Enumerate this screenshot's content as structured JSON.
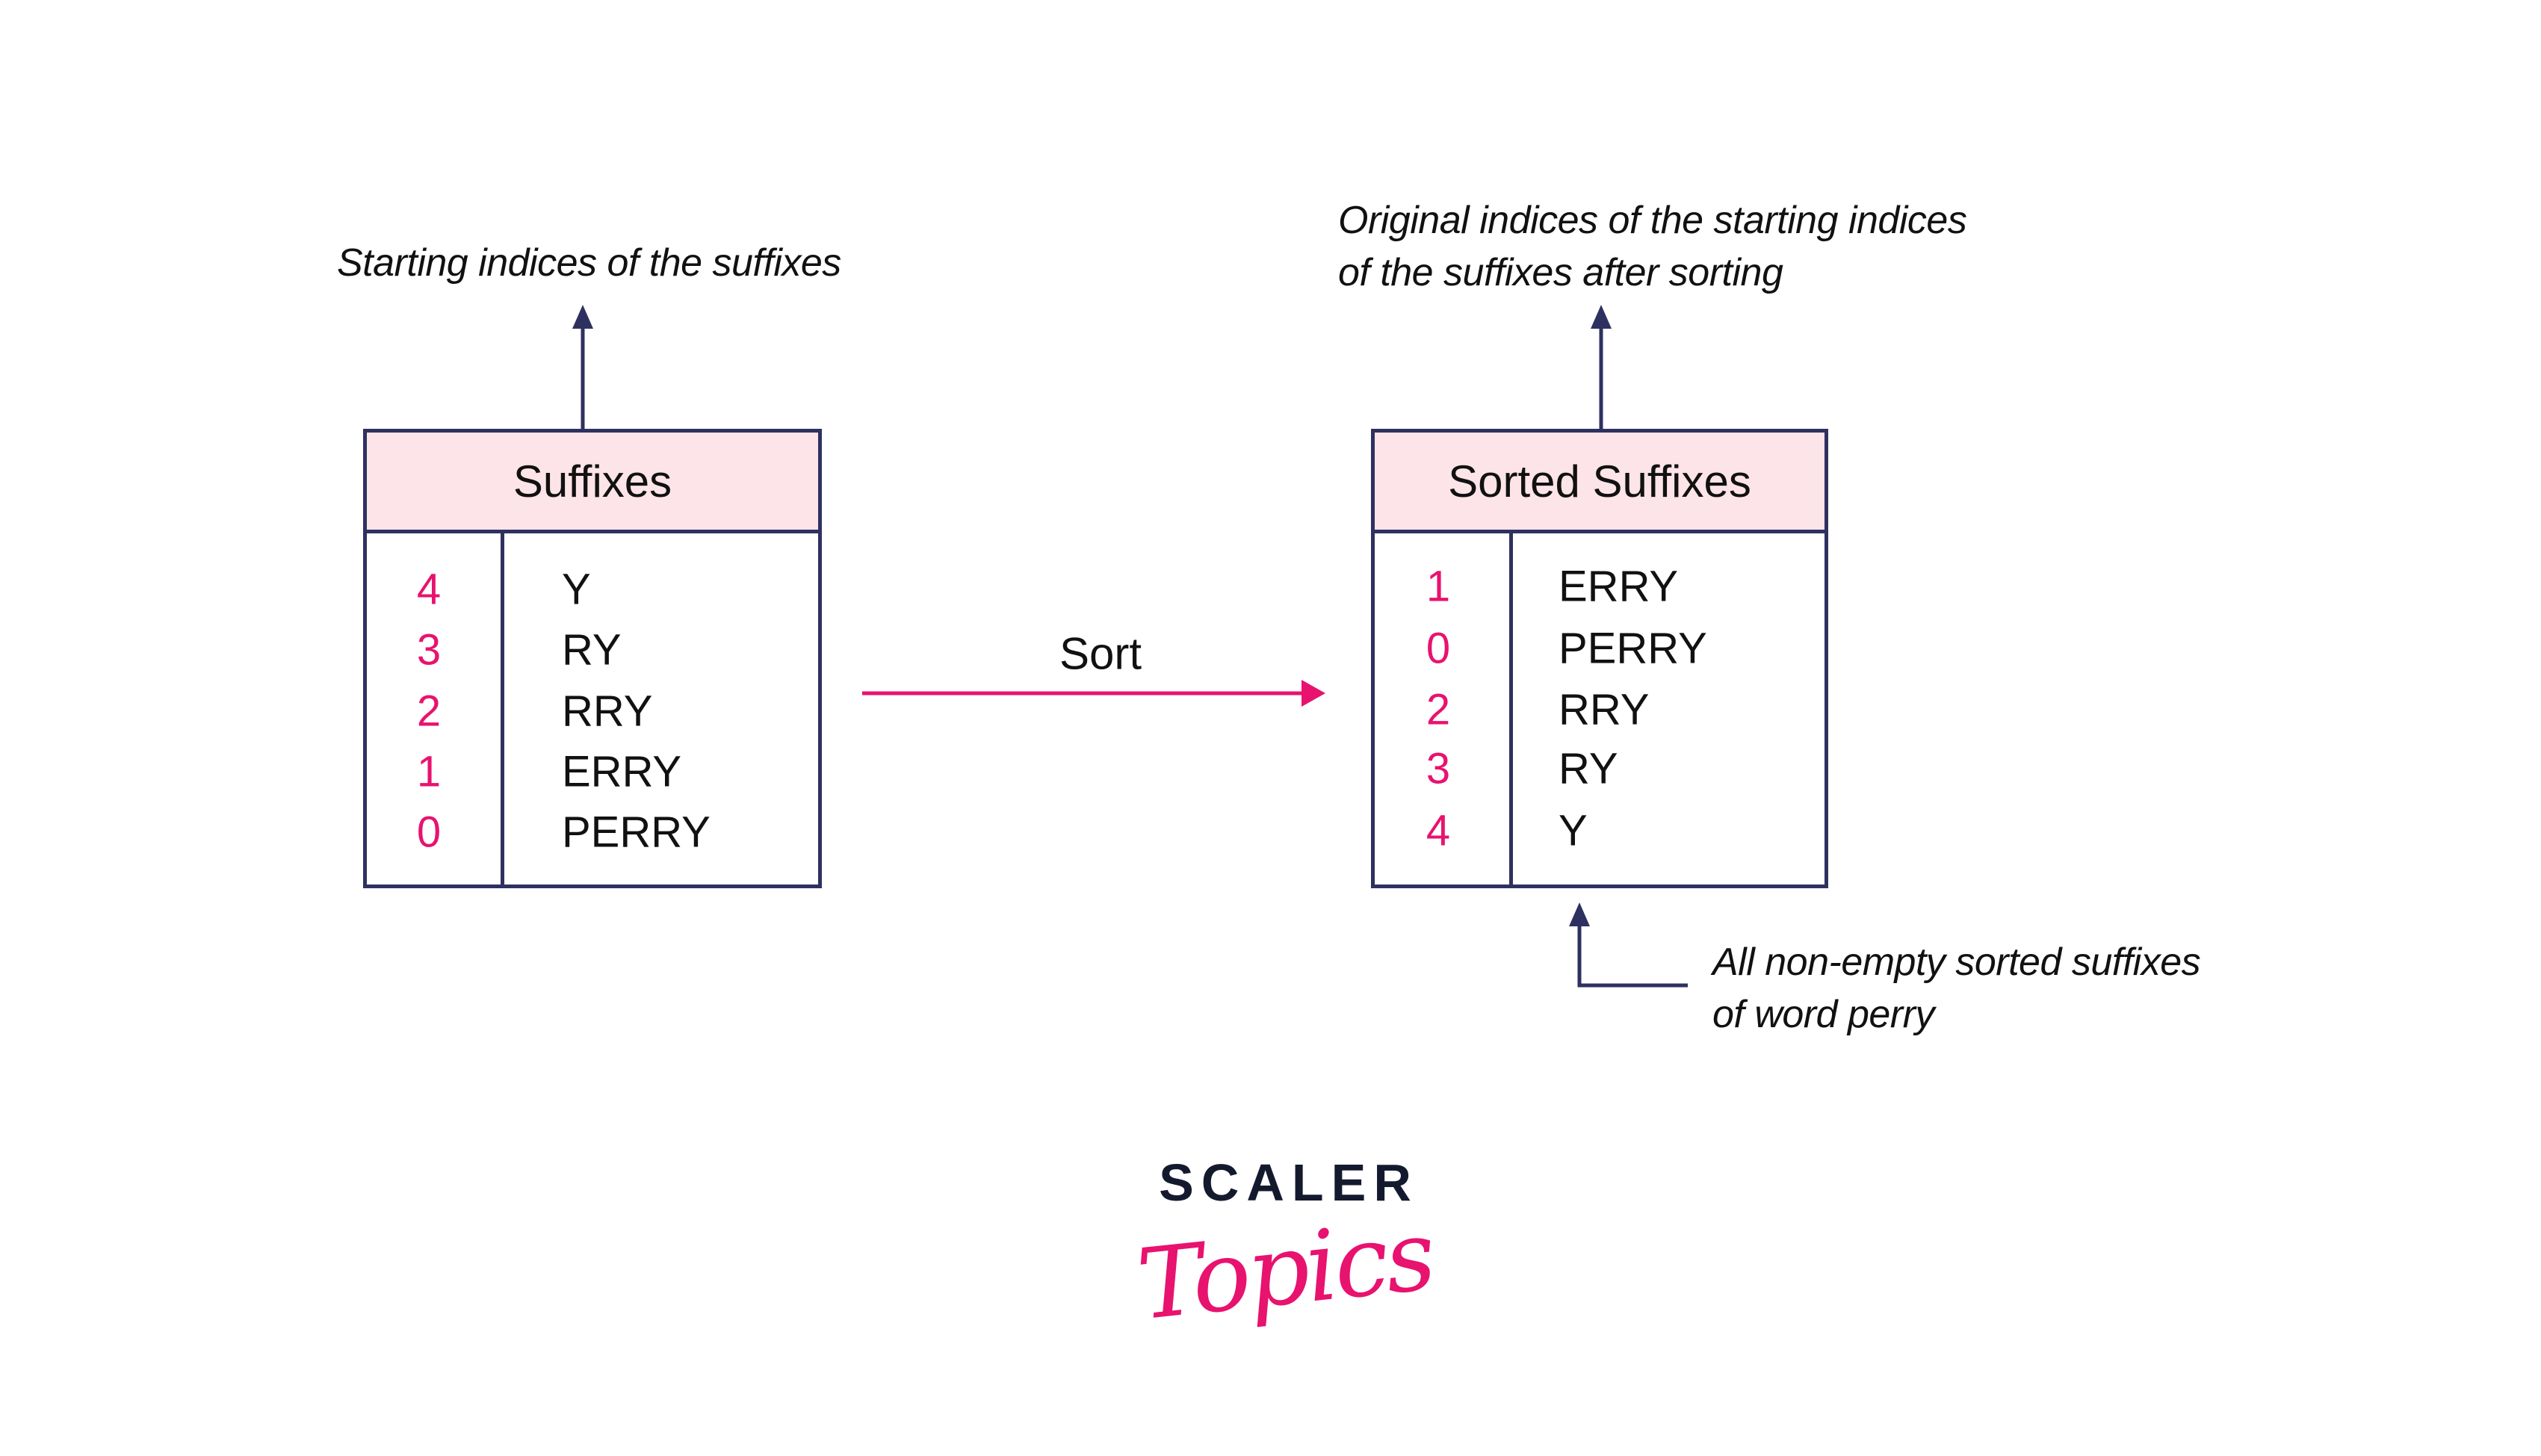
{
  "left_panel": {
    "caption": "Starting indices of the suffixes",
    "table_title": "Suffixes",
    "rows": [
      {
        "index": "4",
        "suffix": "Y"
      },
      {
        "index": "3",
        "suffix": "RY"
      },
      {
        "index": "2",
        "suffix": "RRY"
      },
      {
        "index": "1",
        "suffix": "ERRY"
      },
      {
        "index": "0",
        "suffix": "PERRY"
      }
    ]
  },
  "transition": {
    "label": "Sort"
  },
  "right_panel": {
    "caption_lines": [
      "Original indices of the starting indices",
      "of the suffixes after sorting"
    ],
    "table_title": "Sorted Suffixes",
    "rows": [
      {
        "index": "1",
        "suffix": "ERRY"
      },
      {
        "index": "0",
        "suffix": "PERRY"
      },
      {
        "index": "2",
        "suffix": "RRY"
      },
      {
        "index": "3",
        "suffix": "RY"
      },
      {
        "index": "4",
        "suffix": "Y"
      }
    ],
    "annotation_lines": [
      "All non-empty sorted suffixes",
      "of word perry"
    ]
  },
  "logo": {
    "top": "SCALER",
    "bottom": "Topics"
  },
  "colors": {
    "accent": "#e8126f",
    "border": "#2e3160",
    "header_fill": "#fde4e8",
    "text": "#111111"
  }
}
